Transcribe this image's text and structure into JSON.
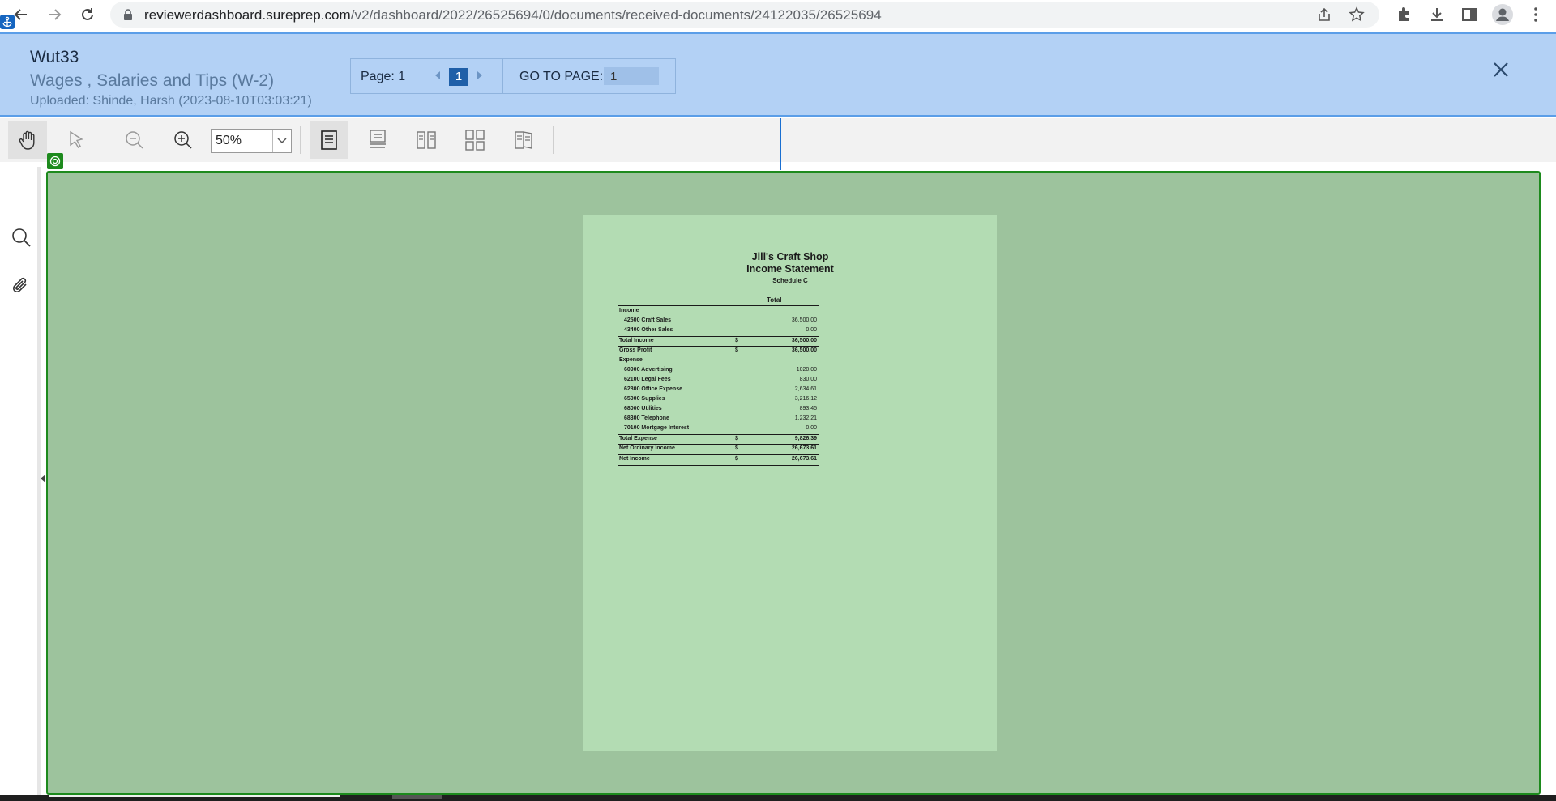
{
  "browser": {
    "url_host": "reviewerdashboard.sureprep.com",
    "url_path": "/v2/dashboard/2022/26525694/0/documents/received-documents/24122035/26525694"
  },
  "header": {
    "client": "Wut33",
    "doc_type": "Wages , Salaries and Tips (W-2)",
    "uploaded": "Uploaded: Shinde, Harsh (2023-08-10T03:03:21)",
    "page_label": "Page: 1",
    "current_page": "1",
    "goto_label": "GO TO PAGE:",
    "goto_value": "1"
  },
  "toolbar": {
    "zoom": "50%"
  },
  "document": {
    "company": "Jill's Craft Shop",
    "title": "Income Statement",
    "subtitle": "Schedule C",
    "column_header": "Total",
    "rows": [
      {
        "label": "Income",
        "cur": "",
        "amount": ""
      },
      {
        "label": "42500 Craft Sales",
        "cur": "",
        "amount": "36,500.00"
      },
      {
        "label": "43400 Other Sales",
        "cur": "",
        "amount": "0.00"
      },
      {
        "label": "Total Income",
        "cur": "$",
        "amount": "36,500.00"
      },
      {
        "label": "Gross Profit",
        "cur": "$",
        "amount": "36,500.00"
      },
      {
        "label": "Expense",
        "cur": "",
        "amount": ""
      },
      {
        "label": "60900 Advertising",
        "cur": "",
        "amount": "1020.00"
      },
      {
        "label": "62100 Legal Fees",
        "cur": "",
        "amount": "830.00"
      },
      {
        "label": "62800 Office Expense",
        "cur": "",
        "amount": "2,634.61"
      },
      {
        "label": "65000 Supplies",
        "cur": "",
        "amount": "3,216.12"
      },
      {
        "label": "68000 Utilities",
        "cur": "",
        "amount": "893.45"
      },
      {
        "label": "68300 Telephone",
        "cur": "",
        "amount": "1,232.21"
      },
      {
        "label": "70100 Mortgage Interest",
        "cur": "",
        "amount": "0.00"
      },
      {
        "label": "Total Expense",
        "cur": "$",
        "amount": "9,826.39"
      },
      {
        "label": "Net Ordinary Income",
        "cur": "$",
        "amount": "26,673.61"
      },
      {
        "label": "Net Income",
        "cur": "$",
        "amount": "26,673.61"
      }
    ]
  },
  "colors": {
    "header_band": "#b3d1f5",
    "page_badge": "#1f5fa8",
    "canvas_bg": "#9dc39d",
    "canvas_border": "#1d8a1d",
    "page_bg": "#b3dcb3"
  }
}
